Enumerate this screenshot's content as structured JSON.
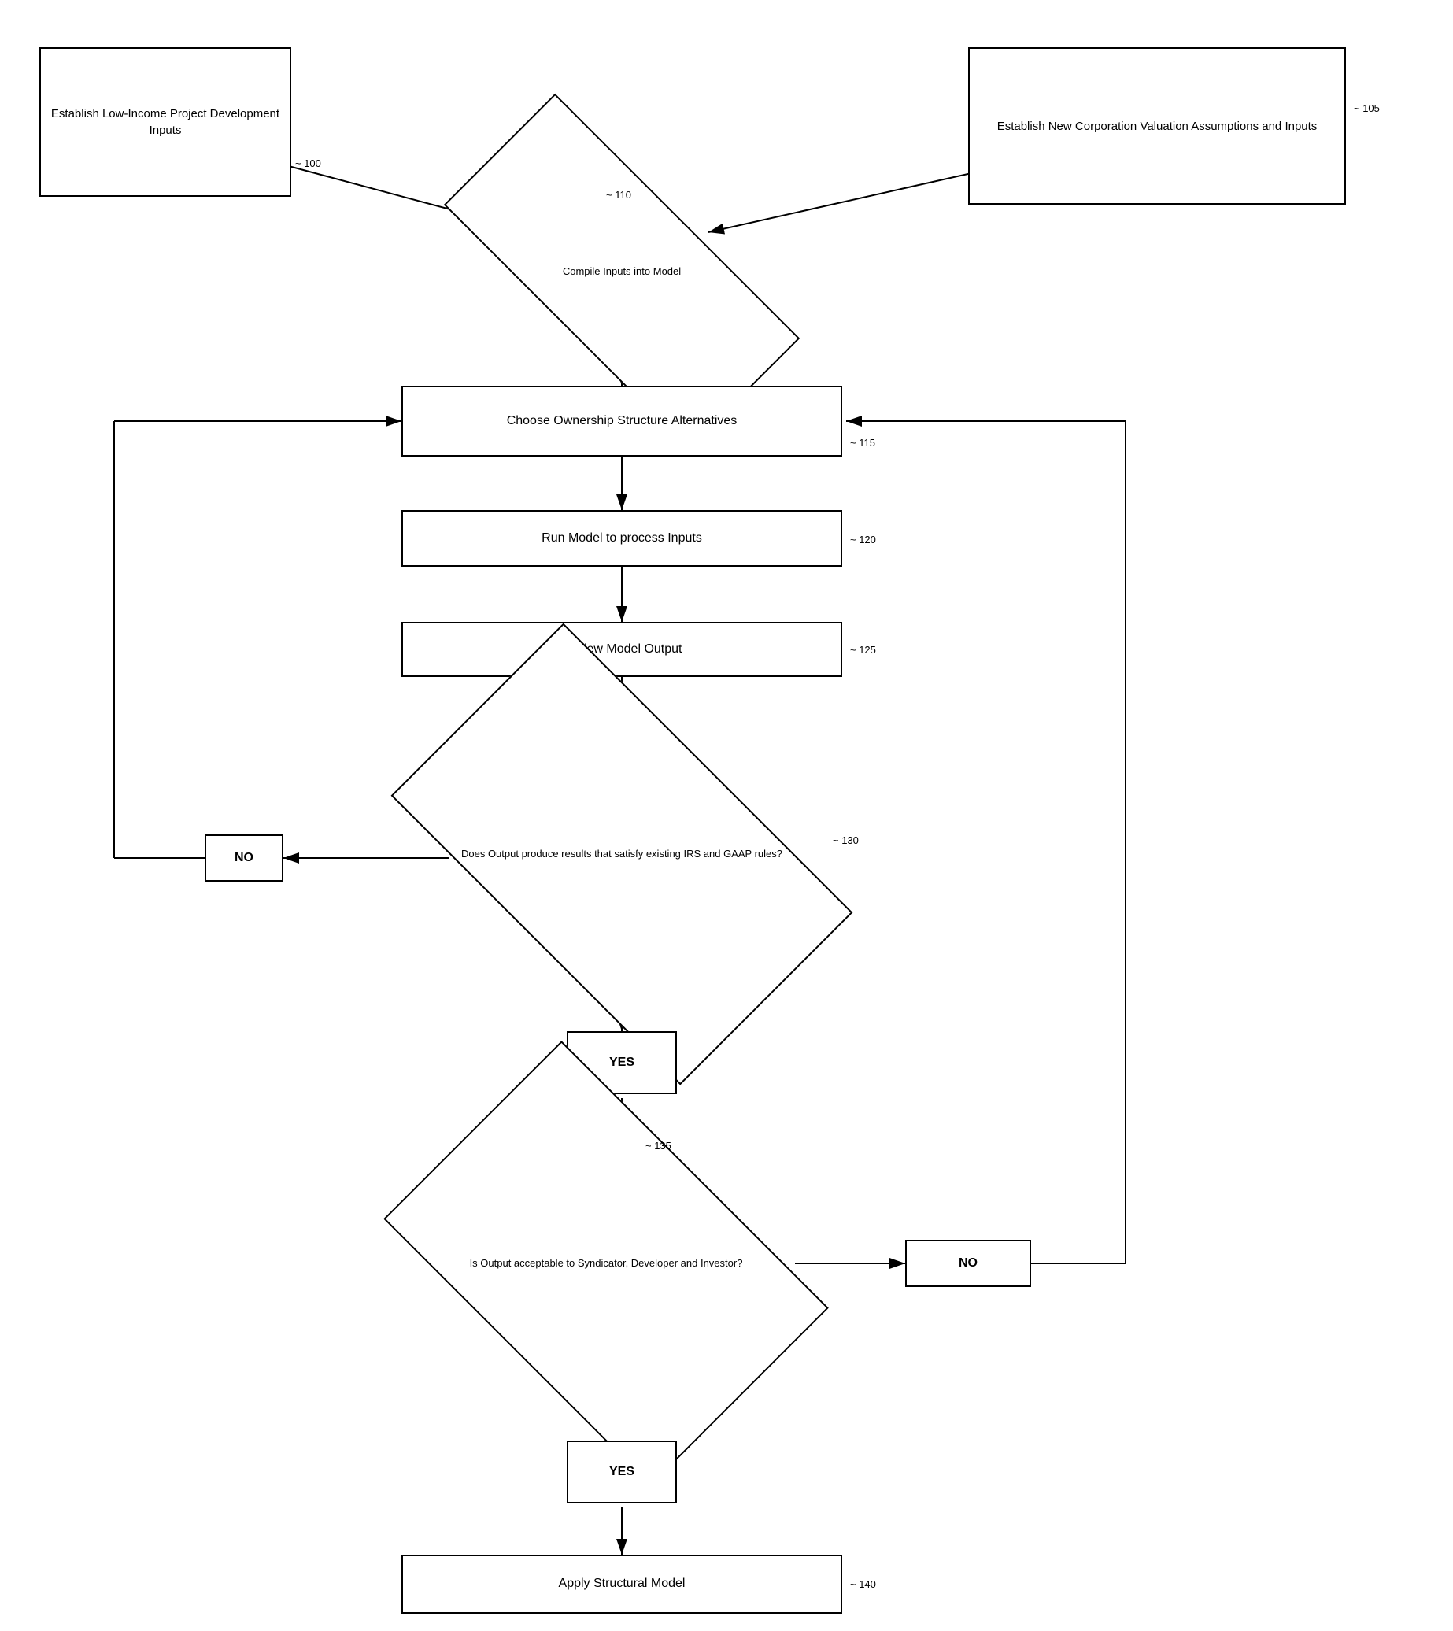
{
  "boxes": {
    "establish_low_income": {
      "label": "Establish\nLow-Income Project\nDevelopment Inputs",
      "ref": "100"
    },
    "establish_new_corp": {
      "label": "Establish\nNew Corporation Valuation\nAssumptions and Inputs",
      "ref": "105"
    },
    "compile_inputs": {
      "label": "Compile Inputs\ninto Model",
      "ref": "110",
      "type": "diamond"
    },
    "choose_ownership": {
      "label": "Choose Ownership Structure Alternatives",
      "ref": "115"
    },
    "run_model": {
      "label": "Run Model to process Inputs",
      "ref": "120"
    },
    "review_model": {
      "label": "Review Model Output",
      "ref": "125"
    },
    "does_output": {
      "label": "Does Output produce results\nthat satisfy existing IRS and\nGAAP rules?",
      "ref": "130",
      "type": "diamond"
    },
    "no_label_left": {
      "label": "NO"
    },
    "yes_label_1": {
      "label": "YES"
    },
    "is_output_acceptable": {
      "label": "Is Output acceptable\nto Syndicator, Developer and\nInvestor?",
      "ref": "135",
      "type": "diamond"
    },
    "no_label_right": {
      "label": "NO"
    },
    "yes_label_2": {
      "label": "YES"
    },
    "apply_structural": {
      "label": "Apply Structural Model",
      "ref": "140"
    }
  }
}
